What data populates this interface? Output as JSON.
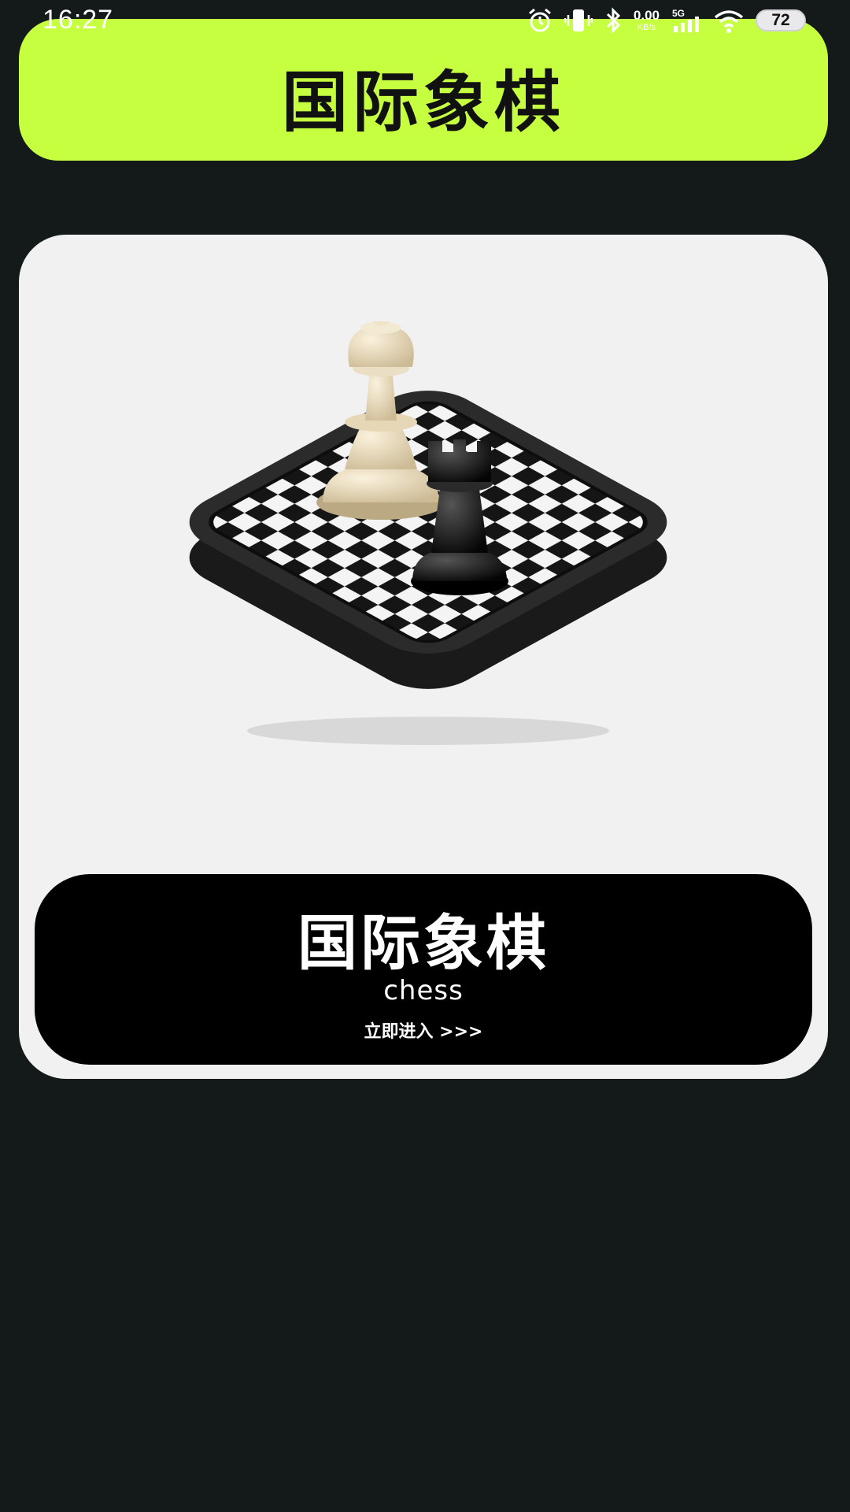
{
  "status_bar": {
    "time": "16:27",
    "net_speed_value": "0.00",
    "net_speed_unit": "KB/s",
    "network_type": "5G",
    "battery_level": "72",
    "icons": [
      "alarm-icon",
      "vibrate-icon",
      "bluetooth-icon",
      "netspeed",
      "signal-icon",
      "wifi-icon",
      "battery-icon"
    ]
  },
  "header": {
    "title": "国际象棋"
  },
  "game_card": {
    "image_description_icon": "chess-board-icon",
    "title": "国际象棋",
    "subtitle": "chess",
    "enter_label": "立即进入 >>>"
  },
  "colors": {
    "background": "#141a1a",
    "header_accent": "#c5ff40",
    "card_background": "#f1f1f2",
    "banner_background": "#000000"
  }
}
